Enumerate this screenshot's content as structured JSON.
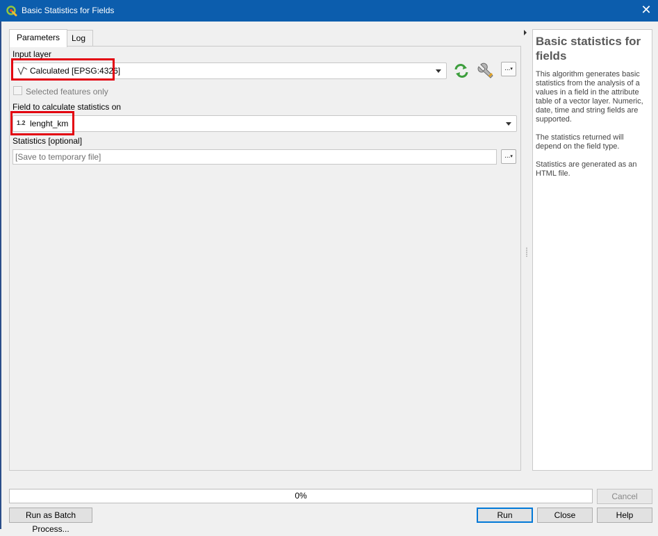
{
  "window": {
    "title": "Basic Statistics for Fields"
  },
  "tabs": [
    {
      "label": "Parameters",
      "active": true
    },
    {
      "label": "Log",
      "active": false
    }
  ],
  "params": {
    "input_layer": {
      "label": "Input layer",
      "value": "Calculated [EPSG:4326]",
      "layer_icon": "line-layer-icon",
      "iterate_icon": "iterate-features-icon",
      "settings_icon": "wrench-icon",
      "more_label": "..."
    },
    "selected_only": {
      "label": "Selected features only",
      "checked": false
    },
    "field": {
      "label": "Field to calculate statistics on",
      "type_badge": "1.2",
      "value": "lenght_km"
    },
    "statistics": {
      "label": "Statistics [optional]",
      "placeholder": "[Save to temporary file]",
      "more_label": "..."
    }
  },
  "help": {
    "title": "Basic statistics for fields",
    "paragraphs": [
      "This algorithm generates basic statistics from the analysis of a values in a field in the attribute table of a vector layer. Numeric, date, time and string fields are supported.",
      "The statistics returned will depend on the field type.",
      "Statistics are generated as an HTML file."
    ]
  },
  "progress": {
    "value": 0,
    "text": "0%"
  },
  "buttons": {
    "cancel": "Cancel",
    "batch": "Run as Batch Process...",
    "run": "Run",
    "close": "Close",
    "help": "Help"
  },
  "colors": {
    "titlebar": "#0c5dad",
    "highlight": "#e3000f",
    "iterate_icon": "#3d9e3d",
    "focus": "#0078d7"
  }
}
